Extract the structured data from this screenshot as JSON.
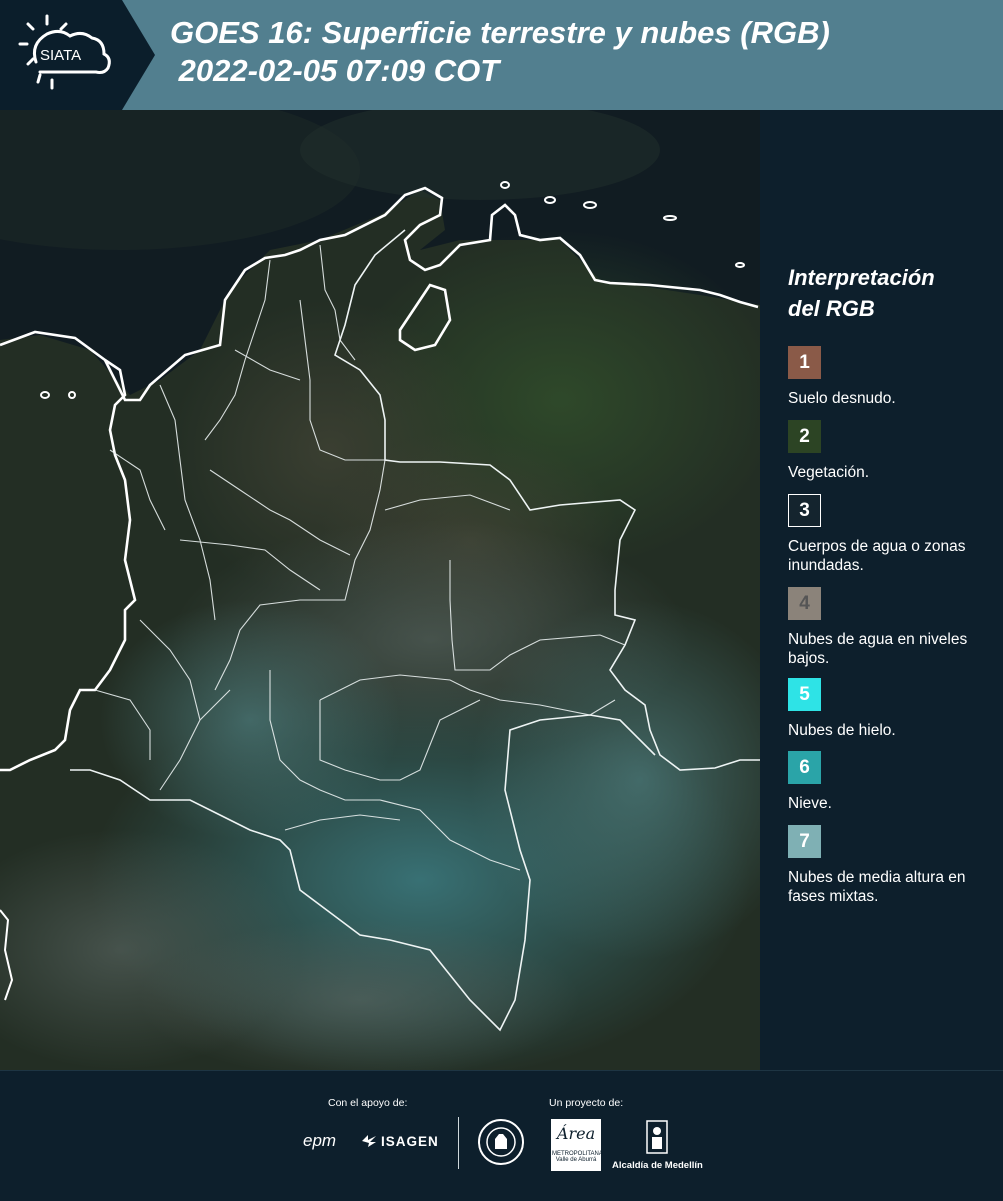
{
  "header": {
    "title_line1": "GOES 16: Superficie terrestre y nubes (RGB)",
    "title_line2": " 2022-02-05 07:09 COT",
    "logo_text": "SIATA"
  },
  "legend": {
    "title_line1": "Interpretación",
    "title_line2": "del RGB",
    "items": [
      {
        "number": "1",
        "color": "#8a5a48",
        "label": "Suelo desnudo."
      },
      {
        "number": "2",
        "color": "#2c4424",
        "label": "Vegetación."
      },
      {
        "number": "3",
        "color": "#14242e",
        "label": "Cuerpos de agua o zonas inundadas."
      },
      {
        "number": "4",
        "color": "#8b837a",
        "label": "Nubes de agua en niveles bajos."
      },
      {
        "number": "5",
        "color": "#2ee3e6",
        "label": "Nubes de hielo."
      },
      {
        "number": "6",
        "color": "#2aa4a8",
        "label": "Nieve."
      },
      {
        "number": "7",
        "color": "#7fb0b4",
        "label": "Nubes de media altura en fases mixtas."
      }
    ]
  },
  "footer": {
    "support_label": "Con el apoyo de:",
    "project_label": "Un proyecto de:",
    "epm_logo": "epm",
    "isagen_logo": "ISAGEN",
    "area_logo_line1": "METROPOLITANA",
    "area_logo_line2": "Valle de Aburrá",
    "area_logo_script": "Área",
    "alcaldia_logo": "Alcaldía de Medellín"
  },
  "colors": {
    "header_bg": "#527f8f",
    "dark_bg": "#0d1f2c"
  }
}
